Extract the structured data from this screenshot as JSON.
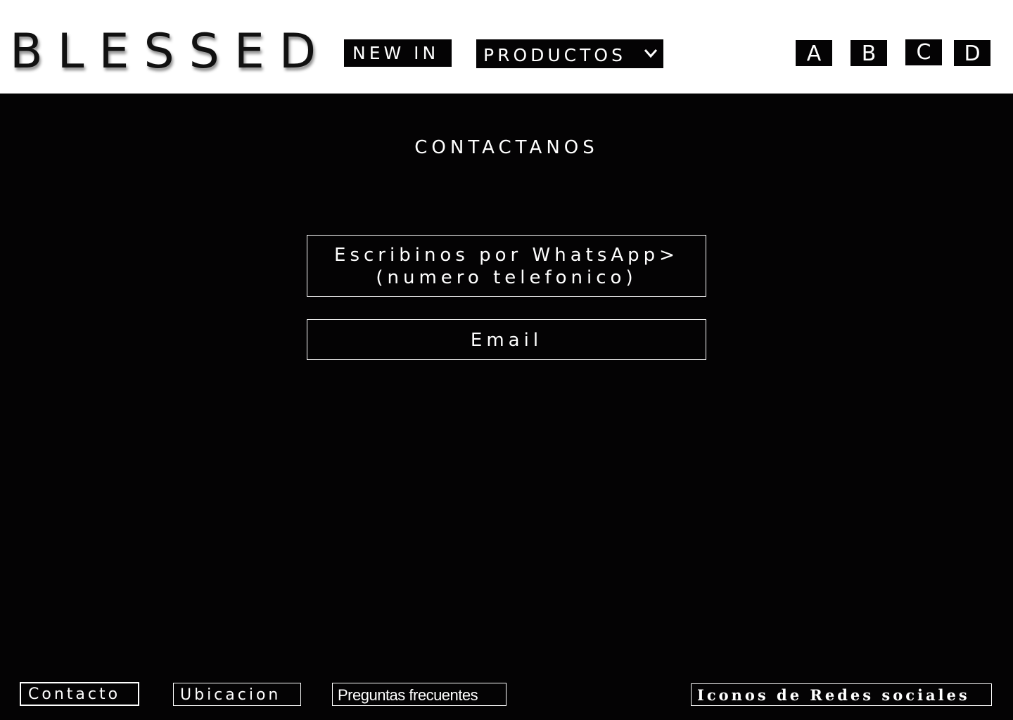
{
  "header": {
    "logo": "BLESSED",
    "nav": {
      "new_in": "NEW IN",
      "productos": "PRODUCTOS"
    },
    "icons": [
      {
        "label": "A"
      },
      {
        "label": "B"
      },
      {
        "label": "C"
      },
      {
        "label": "D"
      }
    ]
  },
  "main": {
    "title": "CONTACTANOS",
    "whatsapp": {
      "line1": "Escribinos por WhatsApp>",
      "line2": "(numero telefonico)"
    },
    "email": "Email"
  },
  "footer": {
    "contacto": "Contacto",
    "ubicacion": "Ubicacion",
    "preguntas": "Preguntas frecuentes",
    "redes": "Iconos de Redes sociales"
  },
  "colors": {
    "background": "#040304",
    "header_background": "#ffffff",
    "text_light": "#ffffff",
    "logo_text": "#111111"
  }
}
